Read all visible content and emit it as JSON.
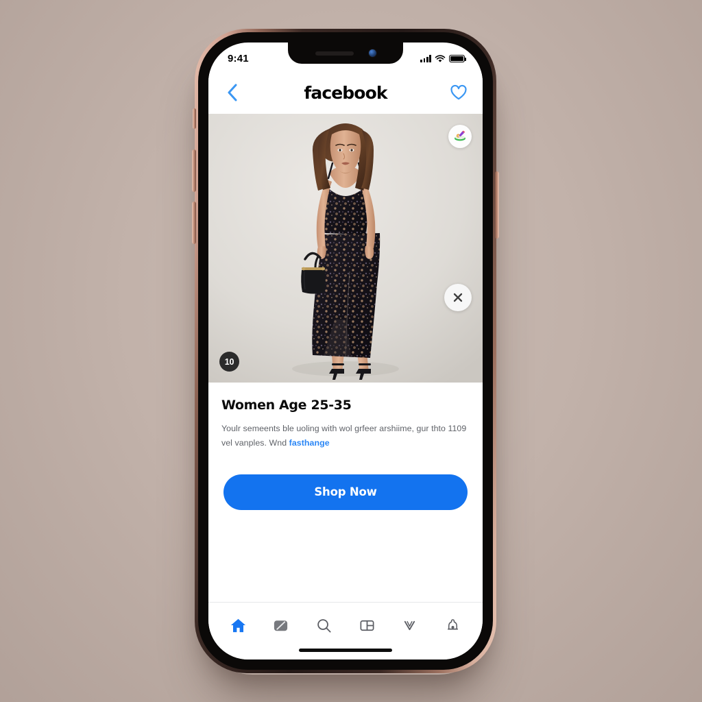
{
  "theme": {
    "backdrop": "#c2b2aa",
    "accent_blue": "#1373ef",
    "link_blue": "#2a86f5",
    "heart_blue": "#3b97f3",
    "text_primary": "#0b0b0b",
    "text_secondary": "#5f6268"
  },
  "status_bar": {
    "time": "9:41",
    "cellular_icon": "signal-bars-icon",
    "wifi_icon": "wifi-icon",
    "battery_icon": "battery-full-icon"
  },
  "header": {
    "back_icon": "chevron-left-icon",
    "title": "facebook",
    "heart_icon": "heart-outline-icon"
  },
  "media": {
    "alt": "Woman in black floral slip midi dress with black handbag and heels",
    "count_badge": "10",
    "brand_chip_icon": "brand-avatar-icon",
    "close_icon": "close-x-icon"
  },
  "ad": {
    "title": "Women Age 25-35",
    "description_line1": "Youlr semeents ble uoling with wol grfeer arshiime, gur",
    "description_line2": "thto 1109 vel vanples. Wnd",
    "link_text": "fasthange",
    "cta_label": "Shop Now"
  },
  "tab_bar": {
    "items": [
      {
        "name": "home",
        "icon": "home-icon",
        "active": true
      },
      {
        "name": "video",
        "icon": "video-square-icon",
        "active": false
      },
      {
        "name": "search",
        "icon": "search-icon",
        "active": false
      },
      {
        "name": "marketplace",
        "icon": "marketplace-grid-icon",
        "active": false
      },
      {
        "name": "notifications",
        "icon": "chevron-down-v-icon",
        "active": false
      },
      {
        "name": "profile",
        "icon": "profile-bell-icon",
        "active": false
      }
    ]
  }
}
